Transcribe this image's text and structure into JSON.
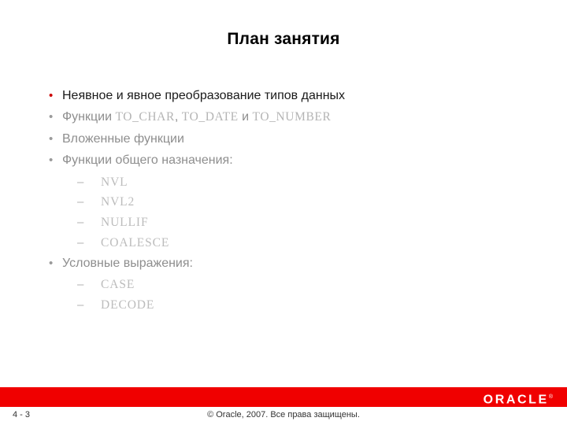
{
  "slide": {
    "title": "План занятия",
    "colors": {
      "accent_red": "#cc0000",
      "bar_red": "#f00000",
      "body_gray": "#8e8e8e",
      "code_gray": "#b4b4b4",
      "title_black": "#000000"
    },
    "bullets": [
      {
        "level": 1,
        "marker": "bullet-dot",
        "emphasis": "strong",
        "text": "Неявное и явное преобразование типов данных"
      },
      {
        "level": 1,
        "marker": "bullet-dot",
        "emphasis": "normal",
        "text_parts": [
          {
            "kind": "text",
            "value": "Функции "
          },
          {
            "kind": "code",
            "value": "TO_CHAR"
          },
          {
            "kind": "text",
            "value": ", "
          },
          {
            "kind": "code",
            "value": "TO_DATE"
          },
          {
            "kind": "text",
            "value": " и "
          },
          {
            "kind": "code",
            "value": "TO_NUMBER"
          }
        ],
        "text": "Функции TO_CHAR, TO_DATE и TO_NUMBER"
      },
      {
        "level": 1,
        "marker": "bullet-dot",
        "emphasis": "normal",
        "text": "Вложенные функции"
      },
      {
        "level": 1,
        "marker": "bullet-dot",
        "emphasis": "normal",
        "text": "Функции общего назначения:"
      },
      {
        "level": 2,
        "marker": "dash",
        "style": "code",
        "text": "NVL"
      },
      {
        "level": 2,
        "marker": "dash",
        "style": "code",
        "text": "NVL2"
      },
      {
        "level": 2,
        "marker": "dash",
        "style": "code",
        "text": "NULLIF"
      },
      {
        "level": 2,
        "marker": "dash",
        "style": "code",
        "text": "COALESCE"
      },
      {
        "level": 1,
        "marker": "bullet-dot",
        "emphasis": "normal",
        "text": "Условные выражения:"
      },
      {
        "level": 2,
        "marker": "dash",
        "style": "code",
        "text": "CASE"
      },
      {
        "level": 2,
        "marker": "dash",
        "style": "code",
        "text": "DECODE"
      }
    ],
    "markers": {
      "dot_glyph": "•",
      "dash_glyph": "–"
    },
    "footer": {
      "page_number": "4 - 3",
      "copyright": "© Oracle, 2007. Все права защищены.",
      "logo_text": "ORACLE",
      "logo_trademark": "®"
    }
  }
}
